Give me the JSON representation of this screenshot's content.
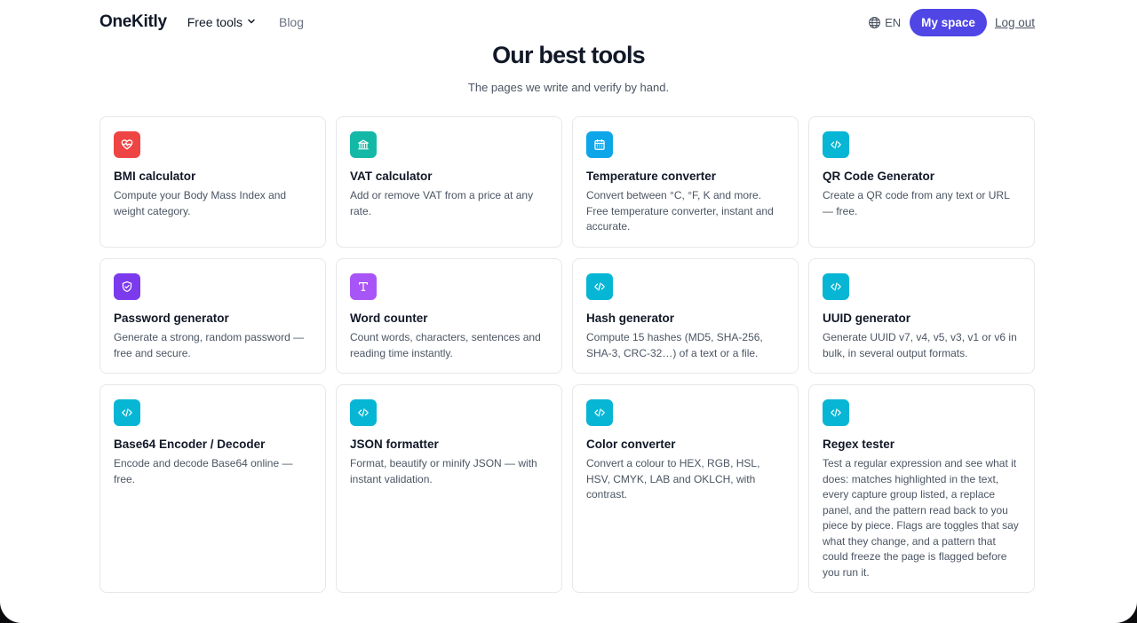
{
  "header": {
    "logo": "OneKitly",
    "nav": {
      "tools_label": "Free tools",
      "blog_label": "Blog"
    },
    "lang": "EN",
    "my_space": "My space",
    "logout": "Log out"
  },
  "main": {
    "title": "Our best tools",
    "subtitle": "The pages we write and verify by hand."
  },
  "tools": [
    {
      "title": "BMI calculator",
      "desc": "Compute your Body Mass Index and weight category.",
      "icon": "heart-pulse-icon",
      "color": "#ef4444"
    },
    {
      "title": "VAT calculator",
      "desc": "Add or remove VAT from a price at any rate.",
      "icon": "bank-icon",
      "color": "#14b8a6"
    },
    {
      "title": "Temperature converter",
      "desc": "Convert between °C, °F, K and more. Free temperature converter, instant and accurate.",
      "icon": "calendar-icon",
      "color": "#0ea5e9"
    },
    {
      "title": "QR Code Generator",
      "desc": "Create a QR code from any text or URL — free.",
      "icon": "code-icon",
      "color": "#06b6d4"
    },
    {
      "title": "Password generator",
      "desc": "Generate a strong, random password — free and secure.",
      "icon": "shield-icon",
      "color": "#7c3aed"
    },
    {
      "title": "Word counter",
      "desc": "Count words, characters, sentences and reading time instantly.",
      "icon": "text-icon",
      "color": "#a855f7"
    },
    {
      "title": "Hash generator",
      "desc": "Compute 15 hashes (MD5, SHA-256, SHA-3, CRC-32…) of a text or a file.",
      "icon": "code-icon",
      "color": "#06b6d4"
    },
    {
      "title": "UUID generator",
      "desc": "Generate UUID v7, v4, v5, v3, v1 or v6 in bulk, in several output formats.",
      "icon": "code-icon",
      "color": "#06b6d4"
    },
    {
      "title": "Base64 Encoder / Decoder",
      "desc": "Encode and decode Base64 online — free.",
      "icon": "code-icon",
      "color": "#06b6d4"
    },
    {
      "title": "JSON formatter",
      "desc": "Format, beautify or minify JSON — with instant validation.",
      "icon": "code-icon",
      "color": "#06b6d4"
    },
    {
      "title": "Color converter",
      "desc": "Convert a colour to HEX, RGB, HSL, HSV, CMYK, LAB and OKLCH, with contrast.",
      "icon": "code-icon",
      "color": "#06b6d4"
    },
    {
      "title": "Regex tester",
      "desc": "Test a regular expression and see what it does: matches highlighted in the text, every capture group listed, a replace panel, and the pattern read back to you piece by piece. Flags are toggles that say what they change, and a pattern that could freeze the page is flagged before you run it.",
      "icon": "code-icon",
      "color": "#06b6d4"
    }
  ],
  "colors": {
    "accent": "#4f46e5"
  }
}
